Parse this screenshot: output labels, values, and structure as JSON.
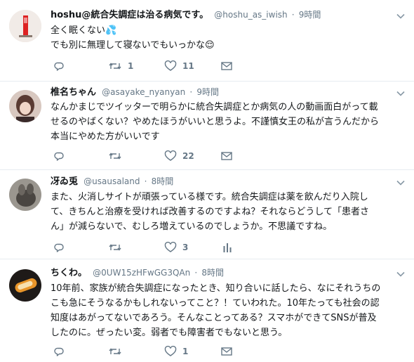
{
  "tweets": [
    {
      "name": "hoshu@統合失調症は治る病気です。",
      "handle": "@hoshu_as_iwish",
      "separator": "·",
      "time": "9時間",
      "lines": [
        "全く眠くない💦",
        "でも別に無理して寝ないでもいっかな😌"
      ],
      "reply_count": "",
      "retweet_count": "1",
      "like_count": "11",
      "extra_icon": "mail-icon"
    },
    {
      "name": "椎名ちゃん",
      "handle": "@asayake_nyanyan",
      "separator": "·",
      "time": "9時間",
      "lines": [
        "なんかまじでツイッターで明らかに統合失調症とか病気の人の動画面白がって載",
        "せるのやばくない？やめたほうがいいと思うよ。不謹慎女王の私が言うんだから",
        "本当にやめた方がいいです"
      ],
      "reply_count": "",
      "retweet_count": "",
      "like_count": "22",
      "extra_icon": "mail-icon"
    },
    {
      "name": "冴ゐ兎",
      "handle": "@usausaland",
      "separator": "·",
      "time": "8時間",
      "lines": [
        "また、火消しサイトが頑張っている様です。統合失調症は薬を飲んだり入院し",
        "て、きちんと治療を受ければ改善するのですよね？それならどうして「患者さ",
        "ん」が減らないで、むしろ増えているのでしょうか。不思議ですね。"
      ],
      "reply_count": "",
      "retweet_count": "",
      "like_count": "3",
      "extra_icon": "analytics-icon"
    },
    {
      "name": "ちくわ。",
      "handle": "@0UW15zHFwGG3QAn",
      "separator": "·",
      "time": "8時間",
      "lines": [
        "10年前、家族が統合失調症になったとき、知り合いに話したら、なにそれうちの",
        "こも急にそうなるかもしれないってこと？！ていわれた。10年たっても社会の認",
        "知度はあがってないであろう。そんなことってある？スマホができてSNSが普及",
        "したのに。ぜったい変。弱者でも障害者でもないと思う。"
      ],
      "reply_count": "",
      "retweet_count": "",
      "like_count": "1",
      "extra_icon": "mail-icon"
    }
  ],
  "colors": {
    "text": "#14171a",
    "secondary": "#657786",
    "border": "#e6ecf0"
  }
}
